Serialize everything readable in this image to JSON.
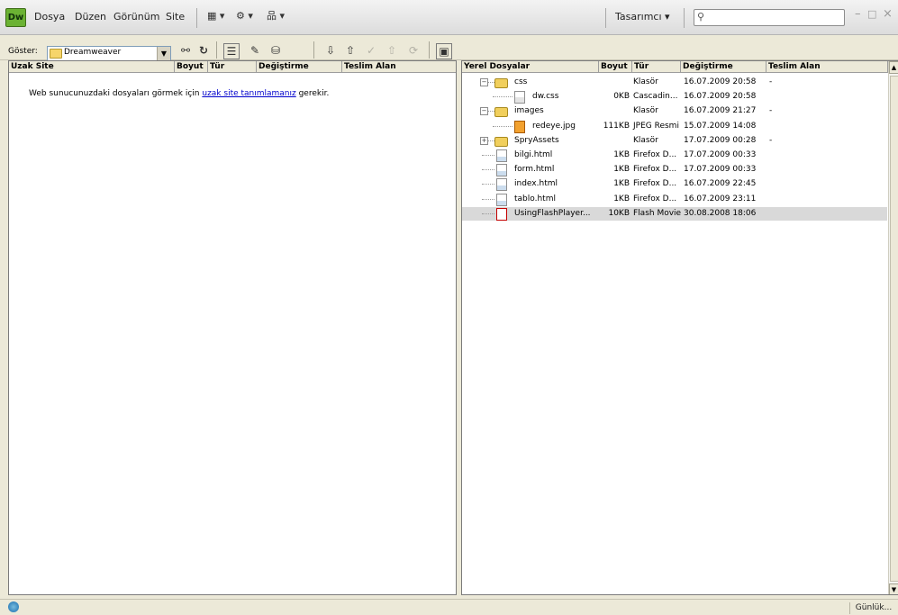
{
  "app": {
    "logo": "Dw"
  },
  "menu": [
    "Dosya",
    "Düzen",
    "Görünüm",
    "Site"
  ],
  "titlebar": {
    "workspace": "Tasarımcı",
    "search_placeholder": "",
    "window_controls": [
      "–",
      "□",
      "×"
    ]
  },
  "toolbar": {
    "show_label": "Göster:",
    "site_value": "Dreamweaver"
  },
  "remote": {
    "columns": [
      "Uzak Site",
      "Boyut",
      "Tür",
      "Değiştirme",
      "Teslim Alan"
    ],
    "message_before": "Web sunucunuzdaki dosyaları görmek için ",
    "message_link": "uzak site tanımlamanız",
    "message_after": " gerekir."
  },
  "local": {
    "columns": [
      "Yerel Dosyalar",
      "Boyut",
      "Tür",
      "Değiştirme",
      "Teslim Alan"
    ],
    "rows": [
      {
        "name": "css",
        "size": "",
        "type": "Klasör",
        "modified": "16.07.2009 20:58",
        "checkout": "-",
        "kind": "folder",
        "level": 0,
        "expander": "−"
      },
      {
        "name": "dw.css",
        "size": "0KB",
        "type": "Cascadin...",
        "modified": "16.07.2009 20:58",
        "checkout": "",
        "kind": "css",
        "level": 1,
        "expander": ""
      },
      {
        "name": "images",
        "size": "",
        "type": "Klasör",
        "modified": "16.07.2009 21:27",
        "checkout": "-",
        "kind": "folder",
        "level": 0,
        "expander": "−"
      },
      {
        "name": "redeye.jpg",
        "size": "111KB",
        "type": "JPEG Resmi",
        "modified": "15.07.2009 14:08",
        "checkout": "",
        "kind": "jpg",
        "level": 1,
        "expander": ""
      },
      {
        "name": "SpryAssets",
        "size": "",
        "type": "Klasör",
        "modified": "17.07.2009 00:28",
        "checkout": "-",
        "kind": "folder",
        "level": 0,
        "expander": "+"
      },
      {
        "name": "bilgi.html",
        "size": "1KB",
        "type": "Firefox D...",
        "modified": "17.07.2009 00:33",
        "checkout": "",
        "kind": "html",
        "level": 0,
        "expander": ""
      },
      {
        "name": "form.html",
        "size": "1KB",
        "type": "Firefox D...",
        "modified": "17.07.2009 00:33",
        "checkout": "",
        "kind": "html",
        "level": 0,
        "expander": ""
      },
      {
        "name": "index.html",
        "size": "1KB",
        "type": "Firefox D...",
        "modified": "16.07.2009 22:45",
        "checkout": "",
        "kind": "html",
        "level": 0,
        "expander": ""
      },
      {
        "name": "tablo.html",
        "size": "1KB",
        "type": "Firefox D...",
        "modified": "16.07.2009 23:11",
        "checkout": "",
        "kind": "html",
        "level": 0,
        "expander": ""
      },
      {
        "name": "UsingFlashPlayer...",
        "size": "10KB",
        "type": "Flash Movie",
        "modified": "30.08.2008 18:06",
        "checkout": "",
        "kind": "swf",
        "level": 0,
        "expander": "",
        "selected": true
      }
    ]
  },
  "status": {
    "log_button": "Günlük..."
  }
}
